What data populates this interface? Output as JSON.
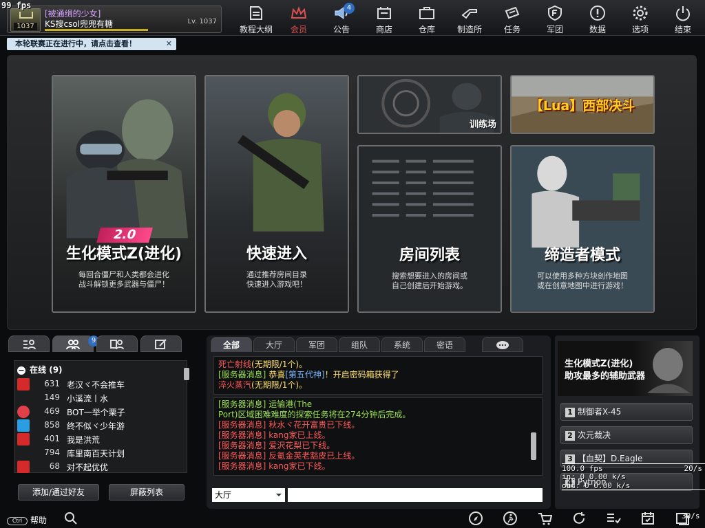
{
  "overlay_fps": "99 fps",
  "profile": {
    "title": "[被通缉的少女]",
    "name": "KS搜csol兜兜有糖",
    "level": "Lv. 1037",
    "avatar_level": "1037",
    "xp": 0.6
  },
  "notice": {
    "text": "本轮联赛正在进行中，请点击查看！",
    "close": "✕"
  },
  "menu": [
    {
      "label": "教程大纲",
      "icon": "tutorial-icon"
    },
    {
      "label": "会员",
      "icon": "crown-icon"
    },
    {
      "label": "公告",
      "icon": "speaker-icon",
      "badge": "4"
    },
    {
      "label": "商店",
      "icon": "shop-icon"
    },
    {
      "label": "仓库",
      "icon": "inventory-icon"
    },
    {
      "label": "制造所",
      "icon": "craft-icon"
    },
    {
      "label": "任务",
      "icon": "mission-icon"
    },
    {
      "label": "军团",
      "icon": "clan-icon"
    },
    {
      "label": "数据",
      "icon": "stats-icon"
    },
    {
      "label": "选项",
      "icon": "gear-icon"
    },
    {
      "label": "结束",
      "icon": "power-icon"
    }
  ],
  "modes": [
    {
      "title": "生化模式Z(进化)",
      "badge": "2.0",
      "desc1": "每回合僵尸和人类都会进化",
      "desc2": "战斗解锁更多武器与僵尸！"
    },
    {
      "title": "快速进入",
      "desc1": "通过推荐房间目录",
      "desc2": "快速进入游戏吧！"
    },
    {
      "title": "房间列表",
      "desc1": "搜索想要进入的房间或",
      "desc2": "自己创建后开始游戏。"
    },
    {
      "title": "缔造者模式",
      "desc1": "可以使用多种方块创作地图",
      "desc2": "或在创意地图中进行游戏！"
    }
  ],
  "small_cards": {
    "training": "训练场",
    "lua": "【Lua】西部决斗"
  },
  "friends": {
    "badge": "9",
    "online_label": "在线",
    "online_count": "(9)",
    "rows": [
      {
        "lv": "631",
        "name": "老汉ヾ不会推车",
        "icon": "rank-a-icon"
      },
      {
        "lv": "149",
        "name": "小溪流丨水",
        "icon": "blank"
      },
      {
        "lv": "469",
        "name": "BOT一举个栗子",
        "icon": "heart-icon"
      },
      {
        "lv": "858",
        "name": "终不似ヾ少年游",
        "icon": "tv-icon"
      },
      {
        "lv": "401",
        "name": "我是洪荒",
        "icon": "da-icon"
      },
      {
        "lv": "794",
        "name": "库里南百天计划",
        "icon": "blank"
      },
      {
        "lv": "68",
        "name": "对不起优优",
        "icon": "rank-a-icon"
      }
    ],
    "add_button": "添加/通过好友",
    "block_button": "屏蔽列表"
  },
  "chat": {
    "tabs": [
      "全部",
      "大厅",
      "军团",
      "组队",
      "系统",
      "密语"
    ],
    "top": [
      [
        {
          "t": "死亡射线",
          "c": "red"
        },
        {
          "t": "(无期限/1个)。",
          "c": "yel"
        }
      ],
      [
        {
          "t": "[服务器消息]",
          "c": "grn"
        },
        {
          "t": " 恭喜",
          "c": "yel"
        },
        {
          "t": "[第五代神]",
          "c": "blu"
        },
        {
          "t": "！开启密码箱获得了",
          "c": "yel"
        }
      ],
      [
        {
          "t": "淬火蒸汽",
          "c": "red"
        },
        {
          "t": "(无期限/1个)。",
          "c": "yel"
        }
      ]
    ],
    "main": [
      [
        {
          "t": "[服务器消息]",
          "c": "grn"
        },
        {
          "t": " 运输港(The",
          "c": "grn"
        }
      ],
      [
        {
          "t": "Port)区域困难难度的探索任务将在274分钟后完成。",
          "c": "grn"
        }
      ],
      [
        {
          "t": "[服务器消息]",
          "c": "red"
        },
        {
          "t": " 秋水ヾ花开富贵已下线。",
          "c": "red"
        }
      ],
      [
        {
          "t": "[服务器消息]",
          "c": "red"
        },
        {
          "t": " kang家已上线。",
          "c": "red"
        }
      ],
      [
        {
          "t": "[服务器消息]",
          "c": "red"
        },
        {
          "t": " 爱沢花梨已下线。",
          "c": "red"
        }
      ],
      [
        {
          "t": "[服务器消息]",
          "c": "red"
        },
        {
          "t": " 反氪金英老豁皮已上线。",
          "c": "red"
        }
      ],
      [
        {
          "t": "[服务器消息]",
          "c": "red"
        },
        {
          "t": " kang家已下线。",
          "c": "red"
        }
      ]
    ],
    "channel": "大厅",
    "input_value": ""
  },
  "weapons": {
    "promo_line1": "生化模式Z(进化)",
    "promo_line2": "助攻最多的辅助武器",
    "items": [
      {
        "n": "1",
        "name": "制御者X-45"
      },
      {
        "n": "2",
        "name": "次元裁决"
      },
      {
        "n": "3",
        "name": "【血契】D.Eagle"
      },
      {
        "n": "4",
        "name": "Python"
      }
    ]
  },
  "stats": {
    "fps": "100.0 fps",
    "fps_right": "20/s",
    "in": "in:  0 0.00 k/s",
    "out": "out:  0 0.00 k/s",
    "rate": "30/s"
  },
  "bottom": {
    "help": "帮助",
    "help_key": "Ctrl"
  }
}
